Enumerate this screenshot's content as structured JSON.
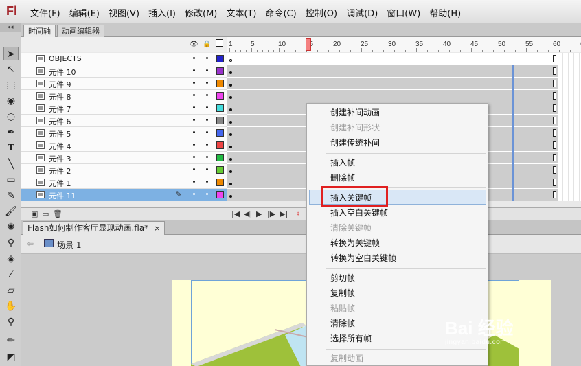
{
  "app": {
    "logo": "Fl"
  },
  "menubar": [
    "文件(F)",
    "编辑(E)",
    "视图(V)",
    "插入(I)",
    "修改(M)",
    "文本(T)",
    "命令(C)",
    "控制(O)",
    "调试(D)",
    "窗口(W)",
    "帮助(H)"
  ],
  "timeline": {
    "tabs": [
      "时间轴",
      "动画编辑器"
    ],
    "ruler": [
      "1",
      "5",
      "10",
      "15",
      "20",
      "25",
      "30",
      "35",
      "40",
      "45",
      "50",
      "55",
      "60",
      "6"
    ],
    "current_frame": 15,
    "layers": [
      {
        "name": "OBJECTS",
        "color": "#2222cc"
      },
      {
        "name": "元件 10",
        "color": "#9933cc"
      },
      {
        "name": "元件 9",
        "color": "#ee8800"
      },
      {
        "name": "元件 8",
        "color": "#ee44ee"
      },
      {
        "name": "元件 7",
        "color": "#44dddd"
      },
      {
        "name": "元件 6",
        "color": "#888888"
      },
      {
        "name": "元件 5",
        "color": "#4466ee"
      },
      {
        "name": "元件 4",
        "color": "#ee4444"
      },
      {
        "name": "元件 3",
        "color": "#22bb44"
      },
      {
        "name": "元件 2",
        "color": "#66cc33"
      },
      {
        "name": "元件 1",
        "color": "#ee8800"
      },
      {
        "name": "元件 11",
        "color": "#ee44ee",
        "selected": true
      }
    ]
  },
  "document": {
    "tab_title": "Flash如何制作客厅显现动画.fla*",
    "close": "×",
    "scene": "场景 1"
  },
  "context_menu": {
    "items": [
      {
        "label": "创建补间动画",
        "enabled": true
      },
      {
        "label": "创建补间形状",
        "enabled": false
      },
      {
        "label": "创建传统补间",
        "enabled": true
      },
      {
        "label": "插入帧",
        "enabled": true
      },
      {
        "label": "删除帧",
        "enabled": true
      },
      {
        "label": "插入关键帧",
        "enabled": true,
        "highlighted": true
      },
      {
        "label": "插入空白关键帧",
        "enabled": true
      },
      {
        "label": "清除关键帧",
        "enabled": false
      },
      {
        "label": "转换为关键帧",
        "enabled": true
      },
      {
        "label": "转换为空白关键帧",
        "enabled": true
      },
      {
        "label": "剪切帧",
        "enabled": true
      },
      {
        "label": "复制帧",
        "enabled": true
      },
      {
        "label": "粘贴帧",
        "enabled": false
      },
      {
        "label": "清除帧",
        "enabled": true
      },
      {
        "label": "选择所有帧",
        "enabled": true
      },
      {
        "label": "复制动画",
        "enabled": false
      }
    ]
  },
  "watermark": {
    "brand": "Bai 经验",
    "url": "jingyan.baidu.com"
  },
  "colors": {
    "highlight": "#d9e7f6",
    "annotation": "#e02020",
    "selected_layer": "#7db1e3"
  }
}
